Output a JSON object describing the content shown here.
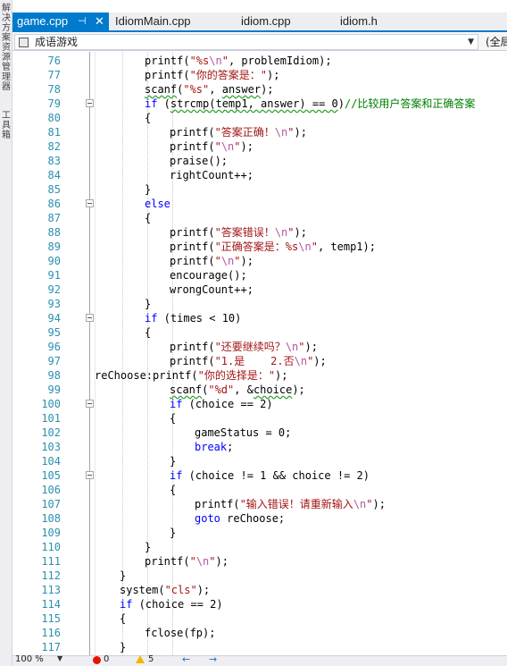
{
  "side_panel": {
    "label_top": "解决方案资源管理器",
    "label_bottom": "工具箱"
  },
  "tabs": [
    {
      "label": "game.cpp",
      "active": true,
      "pin_icon": "pin-icon",
      "close_icon": "close-icon"
    },
    {
      "label": "IdiomMain.cpp",
      "active": false
    },
    {
      "label": "idiom.cpp",
      "active": false
    },
    {
      "label": "idiom.h",
      "active": false
    }
  ],
  "navbar": {
    "scope_label": "成语游戏",
    "member_label": "(全局"
  },
  "editor": {
    "lines": [
      {
        "n": "76",
        "indent": 2,
        "html": "printf(<span class='str'>\"%s<span class='esc'>\\n</span>\"</span>, problemIdiom);"
      },
      {
        "n": "77",
        "indent": 2,
        "html": "printf(<span class='str'>\"你的答案是：\"</span>);"
      },
      {
        "n": "78",
        "indent": 2,
        "html": "<span class='squig'>scanf</span>(<span class='str'>\"%s\"</span>, <span class='squig'>answer</span>);"
      },
      {
        "n": "79",
        "indent": 2,
        "html": "<span class='kw'>if</span> (<span class='squig'>strcmp(temp1, answer) == 0</span>)<span class='cm'>//比较用户答案和正确答案</span>"
      },
      {
        "n": "80",
        "indent": 2,
        "html": "{"
      },
      {
        "n": "81",
        "indent": 3,
        "html": "printf(<span class='str'>\"答案正确！<span class='esc'>\\n</span>\"</span>);"
      },
      {
        "n": "82",
        "indent": 3,
        "html": "printf(<span class='str'>\"<span class='esc'>\\n</span>\"</span>);"
      },
      {
        "n": "83",
        "indent": 3,
        "html": "praise();"
      },
      {
        "n": "84",
        "indent": 3,
        "html": "rightCount++;"
      },
      {
        "n": "85",
        "indent": 2,
        "html": "}"
      },
      {
        "n": "86",
        "indent": 2,
        "html": "<span class='kw'>else</span>"
      },
      {
        "n": "87",
        "indent": 2,
        "html": "{"
      },
      {
        "n": "88",
        "indent": 3,
        "html": "printf(<span class='str'>\"答案错误！<span class='esc'>\\n</span>\"</span>);"
      },
      {
        "n": "89",
        "indent": 3,
        "html": "printf(<span class='str'>\"正确答案是：%s<span class='esc'>\\n</span>\"</span>, temp1);"
      },
      {
        "n": "90",
        "indent": 3,
        "html": "printf(<span class='str'>\"<span class='esc'>\\n</span>\"</span>);"
      },
      {
        "n": "91",
        "indent": 3,
        "html": "encourage();"
      },
      {
        "n": "92",
        "indent": 3,
        "html": "wrongCount++;"
      },
      {
        "n": "93",
        "indent": 2,
        "html": "}"
      },
      {
        "n": "94",
        "indent": 2,
        "html": "<span class='kw'>if</span> (times &lt; 10)"
      },
      {
        "n": "95",
        "indent": 2,
        "html": "{"
      },
      {
        "n": "96",
        "indent": 3,
        "html": "printf(<span class='str'>\"还要继续吗？<span class='esc'>\\n</span>\"</span>);"
      },
      {
        "n": "97",
        "indent": 3,
        "html": "printf(<span class='str'>\"1.是    2.否<span class='esc'>\\n</span>\"</span>);"
      },
      {
        "n": "98",
        "indent": 0,
        "html": "reChoose:printf(<span class='str'>\"你的选择是：\"</span>);"
      },
      {
        "n": "99",
        "indent": 3,
        "html": "<span class='squig'>scanf</span>(<span class='str'>\"%d\"</span>, &amp;<span class='squig'>choice</span>);"
      },
      {
        "n": "100",
        "indent": 3,
        "html": "<span class='kw'>if</span> (choice == 2)"
      },
      {
        "n": "101",
        "indent": 3,
        "html": "{"
      },
      {
        "n": "102",
        "indent": 4,
        "html": "gameStatus = 0;"
      },
      {
        "n": "103",
        "indent": 4,
        "html": "<span class='kw'>break</span>;"
      },
      {
        "n": "104",
        "indent": 3,
        "html": "}"
      },
      {
        "n": "105",
        "indent": 3,
        "html": "<span class='kw'>if</span> (choice != 1 &amp;&amp; choice != 2)"
      },
      {
        "n": "106",
        "indent": 3,
        "html": "{"
      },
      {
        "n": "107",
        "indent": 4,
        "html": "printf(<span class='str'>\"输入错误！请重新输入<span class='esc'>\\n</span>\"</span>);"
      },
      {
        "n": "108",
        "indent": 4,
        "html": "<span class='kw'>goto</span> reChoose;"
      },
      {
        "n": "109",
        "indent": 3,
        "html": "}"
      },
      {
        "n": "110",
        "indent": 2,
        "html": "}"
      },
      {
        "n": "111",
        "indent": 2,
        "html": "printf(<span class='str'>\"<span class='esc'>\\n</span>\"</span>);"
      },
      {
        "n": "112",
        "indent": 1,
        "html": "}"
      },
      {
        "n": "113",
        "indent": 1,
        "html": "system(<span class='str'>\"cls\"</span>);"
      },
      {
        "n": "114",
        "indent": 1,
        "html": "<span class='kw'>if</span> (choice == 2)"
      },
      {
        "n": "115",
        "indent": 1,
        "html": "{"
      },
      {
        "n": "116",
        "indent": 2,
        "html": "fclose(fp);"
      },
      {
        "n": "117",
        "indent": 1,
        "html": "}"
      }
    ],
    "fold_lines": [
      "79",
      "86",
      "94",
      "100",
      "105"
    ]
  },
  "statusbar": {
    "zoom": "100 %",
    "errors": "0",
    "warnings": "5"
  },
  "colors": {
    "accent": "#007acc",
    "keyword": "#0000ff",
    "string": "#a31515",
    "comment": "#008000",
    "line_number": "#2b91af"
  }
}
